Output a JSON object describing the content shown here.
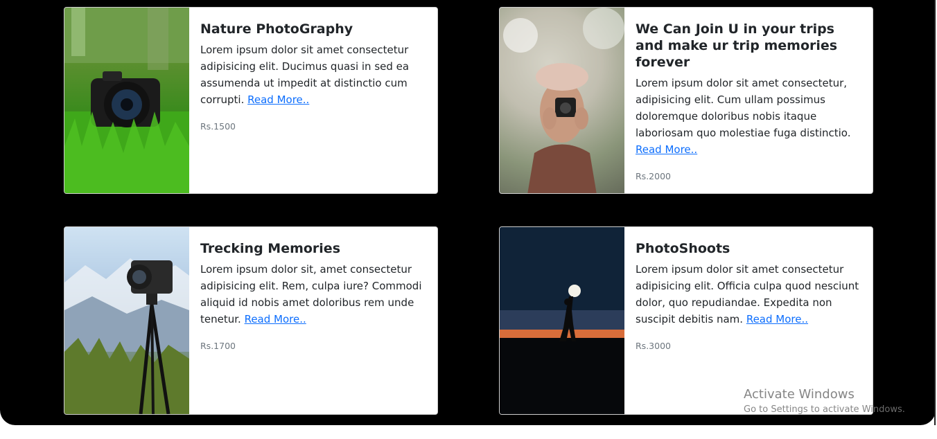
{
  "cards": [
    {
      "title": "Nature PhotoGraphy",
      "text": "Lorem ipsum dolor sit amet consectetur adipisicing elit. Ducimus quasi in sed ea assumenda ut impedit at distinctio cum corrupti.",
      "link": "Read More..",
      "price": "Rs.1500"
    },
    {
      "title": "We Can Join U in your trips and make ur trip memories forever",
      "text": "Lorem ipsum dolor sit amet consectetur, adipisicing elit. Cum ullam possimus doloremque doloribus nobis itaque laboriosam quo molestiae fuga distinctio.",
      "link": "Read More..",
      "price": "Rs.2000"
    },
    {
      "title": "Trecking Memories",
      "text": "Lorem ipsum dolor sit, amet consectetur adipisicing elit. Rem, culpa iure? Commodi aliquid id nobis amet doloribus rem unde tenetur.",
      "link": "Read More..",
      "price": "Rs.1700"
    },
    {
      "title": "PhotoShoots",
      "text": "Lorem ipsum dolor sit amet consectetur adipisicing elit. Officia culpa quod nesciunt dolor, quo repudiandae. Expedita non suscipit debitis nam.",
      "link": "Read More..",
      "price": "Rs.3000"
    }
  ],
  "watermark": {
    "title": "Activate Windows",
    "subtitle": "Go to Settings to activate Windows."
  },
  "colors": {
    "page_background": "#000000",
    "card_background": "#ffffff",
    "link": "#0d6efd",
    "price": "#6c757d"
  }
}
